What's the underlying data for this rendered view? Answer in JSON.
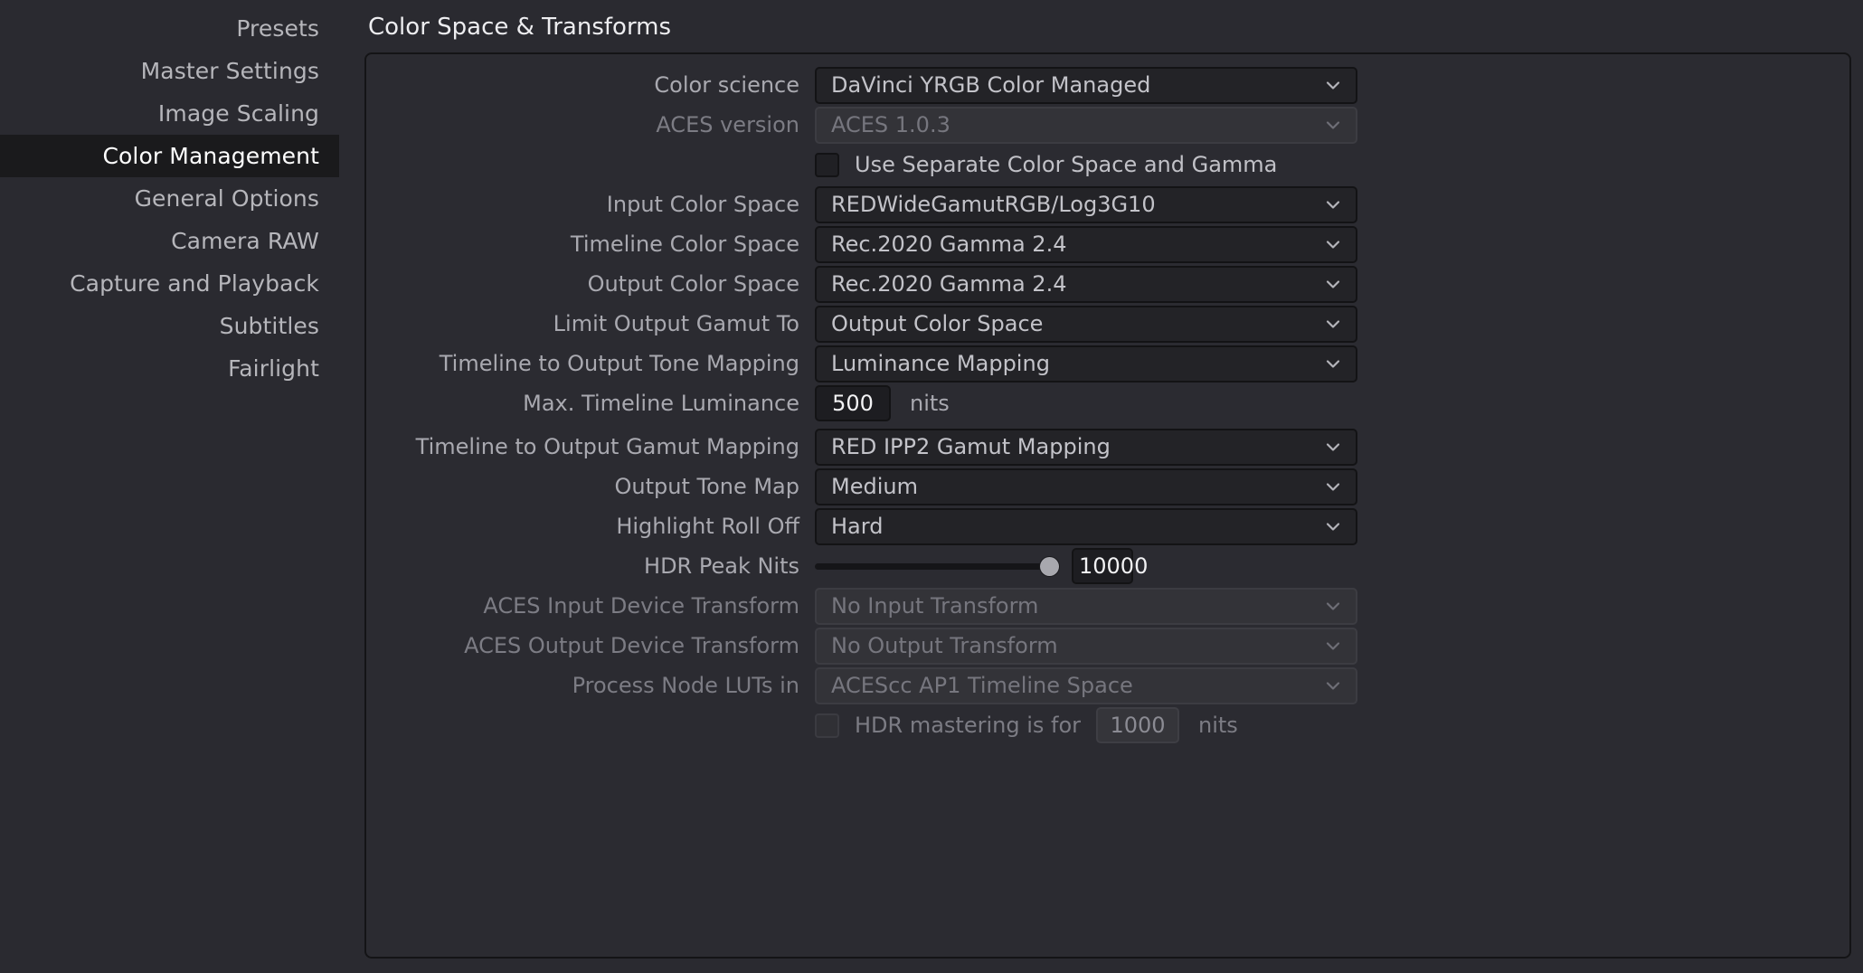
{
  "sidebar": {
    "items": [
      {
        "label": "Presets",
        "active": false
      },
      {
        "label": "Master Settings",
        "active": false
      },
      {
        "label": "Image Scaling",
        "active": false
      },
      {
        "label": "Color Management",
        "active": true
      },
      {
        "label": "General Options",
        "active": false
      },
      {
        "label": "Camera RAW",
        "active": false
      },
      {
        "label": "Capture and Playback",
        "active": false
      },
      {
        "label": "Subtitles",
        "active": false
      },
      {
        "label": "Fairlight",
        "active": false
      }
    ]
  },
  "section": {
    "title": "Color Space & Transforms"
  },
  "fields": {
    "color_science": {
      "label": "Color science",
      "value": "DaVinci YRGB Color Managed",
      "enabled": true
    },
    "aces_version": {
      "label": "ACES version",
      "value": "ACES 1.0.3",
      "enabled": false
    },
    "separate_gamma": {
      "label": "Use Separate Color Space and Gamma",
      "checked": false,
      "enabled": true
    },
    "input_color_space": {
      "label": "Input Color Space",
      "value": "REDWideGamutRGB/Log3G10",
      "enabled": true
    },
    "timeline_color_space": {
      "label": "Timeline Color Space",
      "value": "Rec.2020 Gamma 2.4",
      "enabled": true
    },
    "output_color_space": {
      "label": "Output Color Space",
      "value": "Rec.2020 Gamma 2.4",
      "enabled": true
    },
    "limit_output_gamut": {
      "label": "Limit Output Gamut To",
      "value": "Output Color Space",
      "enabled": true
    },
    "tone_mapping": {
      "label": "Timeline to Output Tone Mapping",
      "value": "Luminance Mapping",
      "enabled": true
    },
    "max_timeline_luminance": {
      "label": "Max. Timeline Luminance",
      "value": "500",
      "unit": "nits",
      "enabled": true
    },
    "gamut_mapping": {
      "label": "Timeline to Output Gamut Mapping",
      "value": "RED IPP2 Gamut Mapping",
      "enabled": true
    },
    "output_tone_map": {
      "label": "Output Tone Map",
      "value": "Medium",
      "enabled": true
    },
    "highlight_roll_off": {
      "label": "Highlight Roll Off",
      "value": "Hard",
      "enabled": true
    },
    "hdr_peak_nits": {
      "label": "HDR Peak Nits",
      "value": "10000",
      "slider_percent": 100,
      "enabled": true
    },
    "aces_idt": {
      "label": "ACES Input Device Transform",
      "value": "No Input Transform",
      "enabled": false
    },
    "aces_odt": {
      "label": "ACES Output Device Transform",
      "value": "No Output Transform",
      "enabled": false
    },
    "process_node_luts": {
      "label": "Process Node LUTs in",
      "value": "ACEScc AP1 Timeline Space",
      "enabled": false
    },
    "hdr_mastering": {
      "label": "HDR mastering is for",
      "value": "1000",
      "unit": "nits",
      "checked": false,
      "enabled": false
    }
  },
  "icons": {
    "chevron_down": "chevron-down-icon"
  },
  "colors": {
    "background": "#2a2a30",
    "panel": "#2b2b31",
    "panel_border": "#141416",
    "sidebar_active_bg": "#1a1a1c",
    "dropdown_bg": "#232327",
    "dropdown_disabled_bg": "#333338",
    "text_primary": "#c3c3c9",
    "text_dim": "#7c7c84",
    "slider_thumb": "#a8a8ae"
  }
}
